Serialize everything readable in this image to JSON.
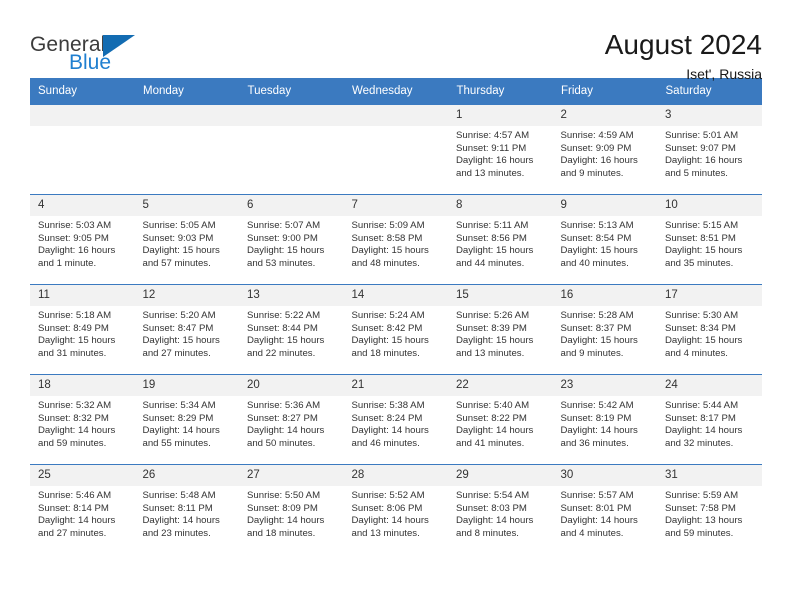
{
  "brand": {
    "line1": "General",
    "line2": "Blue",
    "triangle_icon": "triangle-icon",
    "colors": {
      "blue": "#1f7fd0",
      "triangle": "#136cb2",
      "text": "#3c3c3c"
    }
  },
  "header": {
    "title": "August 2024",
    "subtitle": "Iset', Russia"
  },
  "calendar": {
    "header_bg": "#3b7ac0",
    "daynum_bg": "#f2f2f2",
    "weekdays": [
      "Sunday",
      "Monday",
      "Tuesday",
      "Wednesday",
      "Thursday",
      "Friday",
      "Saturday"
    ],
    "weeks": [
      [
        {
          "day": "",
          "sunrise": "",
          "sunset": "",
          "daylight": "",
          "daylight2": ""
        },
        {
          "day": "",
          "sunrise": "",
          "sunset": "",
          "daylight": "",
          "daylight2": ""
        },
        {
          "day": "",
          "sunrise": "",
          "sunset": "",
          "daylight": "",
          "daylight2": ""
        },
        {
          "day": "",
          "sunrise": "",
          "sunset": "",
          "daylight": "",
          "daylight2": ""
        },
        {
          "day": "1",
          "sunrise": "Sunrise: 4:57 AM",
          "sunset": "Sunset: 9:11 PM",
          "daylight": "Daylight: 16 hours",
          "daylight2": "and 13 minutes."
        },
        {
          "day": "2",
          "sunrise": "Sunrise: 4:59 AM",
          "sunset": "Sunset: 9:09 PM",
          "daylight": "Daylight: 16 hours",
          "daylight2": "and 9 minutes."
        },
        {
          "day": "3",
          "sunrise": "Sunrise: 5:01 AM",
          "sunset": "Sunset: 9:07 PM",
          "daylight": "Daylight: 16 hours",
          "daylight2": "and 5 minutes."
        }
      ],
      [
        {
          "day": "4",
          "sunrise": "Sunrise: 5:03 AM",
          "sunset": "Sunset: 9:05 PM",
          "daylight": "Daylight: 16 hours",
          "daylight2": "and 1 minute."
        },
        {
          "day": "5",
          "sunrise": "Sunrise: 5:05 AM",
          "sunset": "Sunset: 9:03 PM",
          "daylight": "Daylight: 15 hours",
          "daylight2": "and 57 minutes."
        },
        {
          "day": "6",
          "sunrise": "Sunrise: 5:07 AM",
          "sunset": "Sunset: 9:00 PM",
          "daylight": "Daylight: 15 hours",
          "daylight2": "and 53 minutes."
        },
        {
          "day": "7",
          "sunrise": "Sunrise: 5:09 AM",
          "sunset": "Sunset: 8:58 PM",
          "daylight": "Daylight: 15 hours",
          "daylight2": "and 48 minutes."
        },
        {
          "day": "8",
          "sunrise": "Sunrise: 5:11 AM",
          "sunset": "Sunset: 8:56 PM",
          "daylight": "Daylight: 15 hours",
          "daylight2": "and 44 minutes."
        },
        {
          "day": "9",
          "sunrise": "Sunrise: 5:13 AM",
          "sunset": "Sunset: 8:54 PM",
          "daylight": "Daylight: 15 hours",
          "daylight2": "and 40 minutes."
        },
        {
          "day": "10",
          "sunrise": "Sunrise: 5:15 AM",
          "sunset": "Sunset: 8:51 PM",
          "daylight": "Daylight: 15 hours",
          "daylight2": "and 35 minutes."
        }
      ],
      [
        {
          "day": "11",
          "sunrise": "Sunrise: 5:18 AM",
          "sunset": "Sunset: 8:49 PM",
          "daylight": "Daylight: 15 hours",
          "daylight2": "and 31 minutes."
        },
        {
          "day": "12",
          "sunrise": "Sunrise: 5:20 AM",
          "sunset": "Sunset: 8:47 PM",
          "daylight": "Daylight: 15 hours",
          "daylight2": "and 27 minutes."
        },
        {
          "day": "13",
          "sunrise": "Sunrise: 5:22 AM",
          "sunset": "Sunset: 8:44 PM",
          "daylight": "Daylight: 15 hours",
          "daylight2": "and 22 minutes."
        },
        {
          "day": "14",
          "sunrise": "Sunrise: 5:24 AM",
          "sunset": "Sunset: 8:42 PM",
          "daylight": "Daylight: 15 hours",
          "daylight2": "and 18 minutes."
        },
        {
          "day": "15",
          "sunrise": "Sunrise: 5:26 AM",
          "sunset": "Sunset: 8:39 PM",
          "daylight": "Daylight: 15 hours",
          "daylight2": "and 13 minutes."
        },
        {
          "day": "16",
          "sunrise": "Sunrise: 5:28 AM",
          "sunset": "Sunset: 8:37 PM",
          "daylight": "Daylight: 15 hours",
          "daylight2": "and 9 minutes."
        },
        {
          "day": "17",
          "sunrise": "Sunrise: 5:30 AM",
          "sunset": "Sunset: 8:34 PM",
          "daylight": "Daylight: 15 hours",
          "daylight2": "and 4 minutes."
        }
      ],
      [
        {
          "day": "18",
          "sunrise": "Sunrise: 5:32 AM",
          "sunset": "Sunset: 8:32 PM",
          "daylight": "Daylight: 14 hours",
          "daylight2": "and 59 minutes."
        },
        {
          "day": "19",
          "sunrise": "Sunrise: 5:34 AM",
          "sunset": "Sunset: 8:29 PM",
          "daylight": "Daylight: 14 hours",
          "daylight2": "and 55 minutes."
        },
        {
          "day": "20",
          "sunrise": "Sunrise: 5:36 AM",
          "sunset": "Sunset: 8:27 PM",
          "daylight": "Daylight: 14 hours",
          "daylight2": "and 50 minutes."
        },
        {
          "day": "21",
          "sunrise": "Sunrise: 5:38 AM",
          "sunset": "Sunset: 8:24 PM",
          "daylight": "Daylight: 14 hours",
          "daylight2": "and 46 minutes."
        },
        {
          "day": "22",
          "sunrise": "Sunrise: 5:40 AM",
          "sunset": "Sunset: 8:22 PM",
          "daylight": "Daylight: 14 hours",
          "daylight2": "and 41 minutes."
        },
        {
          "day": "23",
          "sunrise": "Sunrise: 5:42 AM",
          "sunset": "Sunset: 8:19 PM",
          "daylight": "Daylight: 14 hours",
          "daylight2": "and 36 minutes."
        },
        {
          "day": "24",
          "sunrise": "Sunrise: 5:44 AM",
          "sunset": "Sunset: 8:17 PM",
          "daylight": "Daylight: 14 hours",
          "daylight2": "and 32 minutes."
        }
      ],
      [
        {
          "day": "25",
          "sunrise": "Sunrise: 5:46 AM",
          "sunset": "Sunset: 8:14 PM",
          "daylight": "Daylight: 14 hours",
          "daylight2": "and 27 minutes."
        },
        {
          "day": "26",
          "sunrise": "Sunrise: 5:48 AM",
          "sunset": "Sunset: 8:11 PM",
          "daylight": "Daylight: 14 hours",
          "daylight2": "and 23 minutes."
        },
        {
          "day": "27",
          "sunrise": "Sunrise: 5:50 AM",
          "sunset": "Sunset: 8:09 PM",
          "daylight": "Daylight: 14 hours",
          "daylight2": "and 18 minutes."
        },
        {
          "day": "28",
          "sunrise": "Sunrise: 5:52 AM",
          "sunset": "Sunset: 8:06 PM",
          "daylight": "Daylight: 14 hours",
          "daylight2": "and 13 minutes."
        },
        {
          "day": "29",
          "sunrise": "Sunrise: 5:54 AM",
          "sunset": "Sunset: 8:03 PM",
          "daylight": "Daylight: 14 hours",
          "daylight2": "and 8 minutes."
        },
        {
          "day": "30",
          "sunrise": "Sunrise: 5:57 AM",
          "sunset": "Sunset: 8:01 PM",
          "daylight": "Daylight: 14 hours",
          "daylight2": "and 4 minutes."
        },
        {
          "day": "31",
          "sunrise": "Sunrise: 5:59 AM",
          "sunset": "Sunset: 7:58 PM",
          "daylight": "Daylight: 13 hours",
          "daylight2": "and 59 minutes."
        }
      ]
    ]
  }
}
